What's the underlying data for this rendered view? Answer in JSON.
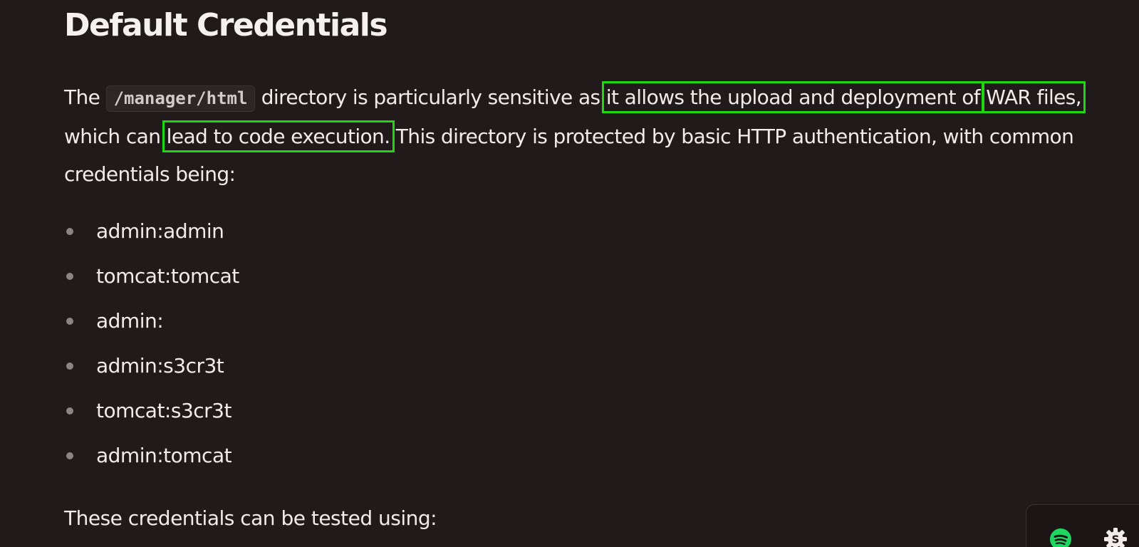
{
  "heading": "Default Credentials",
  "paragraph": {
    "the": "The ",
    "code_path": "/manager/html",
    "after_code": " directory is particularly sensitive as ",
    "highlight_1": "it allows the upload and deployment of",
    "space_1": " ",
    "highlight_2": "WAR files,",
    "after_hl2": " which can ",
    "highlight_3": "lead to code execution.",
    "rest": " This directory is protected by basic HTTP authentication, with common credentials being:"
  },
  "credentials": [
    "admin:admin",
    "tomcat:tomcat",
    "admin:",
    "admin:s3cr3t",
    "tomcat:s3cr3t",
    "admin:tomcat"
  ],
  "tested_text": "These credentials can be tested using:",
  "colors": {
    "background": "#211a1b",
    "highlight_box": "#1ed70f",
    "spotify_green": "#1ed760"
  },
  "widget": {
    "icons": [
      "spotify-icon",
      "gear-icon"
    ],
    "gear_letter": "S"
  }
}
